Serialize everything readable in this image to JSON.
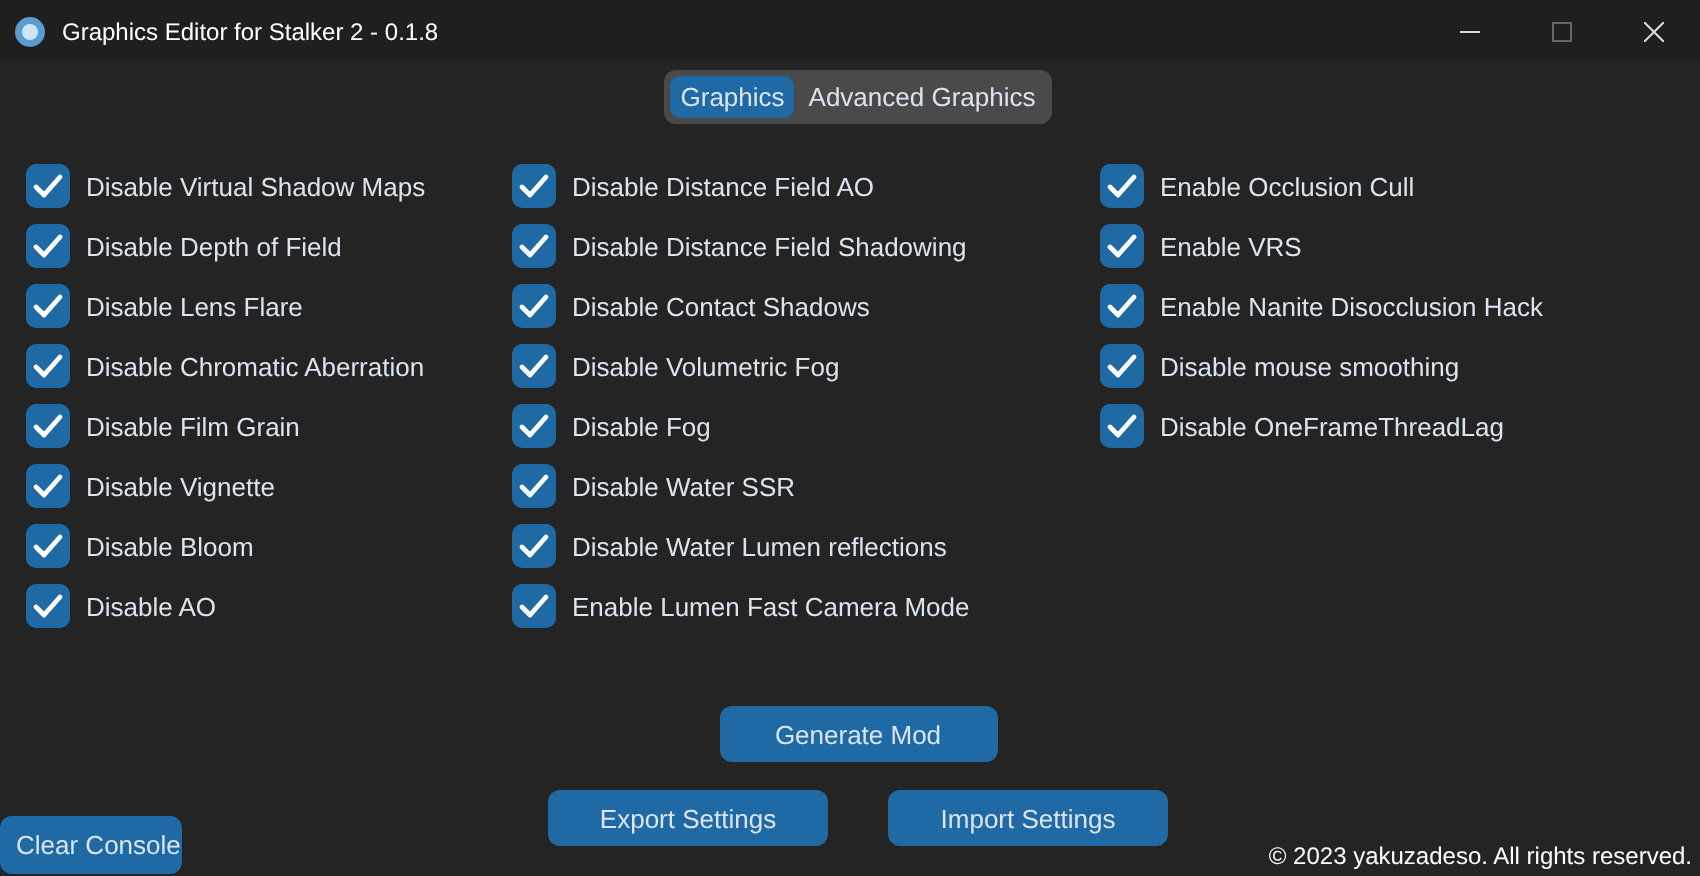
{
  "window": {
    "title": "Graphics Editor for Stalker 2 - 0.1.8"
  },
  "tabs": [
    {
      "label": "Graphics",
      "selected": true
    },
    {
      "label": "Advanced Graphics",
      "selected": false
    }
  ],
  "columns": [
    [
      {
        "label": "Disable Virtual Shadow Maps",
        "checked": true
      },
      {
        "label": "Disable Depth of Field",
        "checked": true
      },
      {
        "label": "Disable Lens Flare",
        "checked": true
      },
      {
        "label": "Disable Chromatic Aberration",
        "checked": true
      },
      {
        "label": "Disable Film Grain",
        "checked": true
      },
      {
        "label": "Disable Vignette",
        "checked": true
      },
      {
        "label": "Disable Bloom",
        "checked": true
      },
      {
        "label": "Disable AO",
        "checked": true
      }
    ],
    [
      {
        "label": "Disable Distance Field AO",
        "checked": true
      },
      {
        "label": "Disable Distance Field Shadowing",
        "checked": true
      },
      {
        "label": "Disable Contact Shadows",
        "checked": true
      },
      {
        "label": "Disable Volumetric Fog",
        "checked": true
      },
      {
        "label": "Disable Fog",
        "checked": true
      },
      {
        "label": "Disable Water SSR",
        "checked": true
      },
      {
        "label": "Disable Water Lumen reflections",
        "checked": true
      },
      {
        "label": "Enable Lumen Fast Camera Mode",
        "checked": true
      }
    ],
    [
      {
        "label": "Enable Occlusion Cull",
        "checked": true
      },
      {
        "label": "Enable VRS",
        "checked": true
      },
      {
        "label": "Enable Nanite Disocclusion Hack",
        "checked": true
      },
      {
        "label": "Disable mouse smoothing",
        "checked": true
      },
      {
        "label": "Disable OneFrameThreadLag",
        "checked": true
      }
    ]
  ],
  "generate_button": "Generate Mod",
  "export_button": "Export Settings",
  "import_button": "Import Settings",
  "clear_button": "Clear Console",
  "copyright": "© 2023 yakuzadeso. All rights reserved."
}
